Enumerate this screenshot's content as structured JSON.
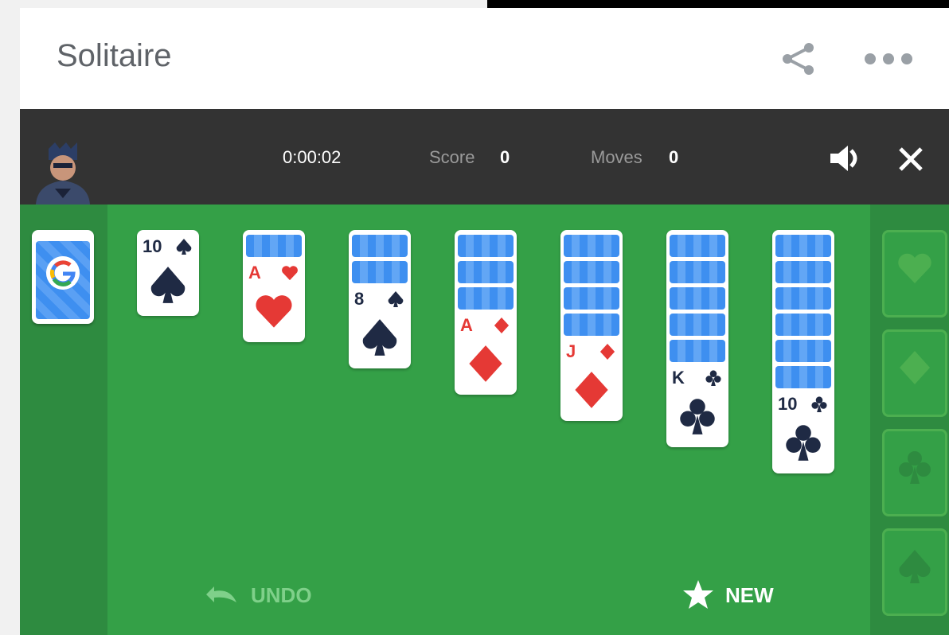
{
  "header": {
    "title": "Solitaire",
    "share_icon": "share-icon",
    "more_icon": "more-horizontal-icon"
  },
  "status_bar": {
    "timer": "0:00:02",
    "score_label": "Score",
    "score_value": "0",
    "moves_label": "Moves",
    "moves_value": "0",
    "sound_icon": "volume-icon",
    "close_icon": "close-icon"
  },
  "tableau": [
    {
      "hidden": 0,
      "rank": "10",
      "suit": "spades"
    },
    {
      "hidden": 1,
      "rank": "A",
      "suit": "hearts"
    },
    {
      "hidden": 2,
      "rank": "8",
      "suit": "spades"
    },
    {
      "hidden": 3,
      "rank": "A",
      "suit": "diamonds"
    },
    {
      "hidden": 4,
      "rank": "J",
      "suit": "diamonds"
    },
    {
      "hidden": 5,
      "rank": "K",
      "suit": "clubs"
    },
    {
      "hidden": 6,
      "rank": "10",
      "suit": "clubs"
    }
  ],
  "foundations": [
    "hearts",
    "diamonds",
    "clubs",
    "spades"
  ],
  "actions": {
    "undo_label": "UNDO",
    "new_label": "NEW"
  },
  "colors": {
    "board": "#34a047",
    "board_dark": "#2e8b40",
    "topbar": "#333333",
    "red_suit": "#e53935",
    "black_suit": "#1f2a44"
  }
}
